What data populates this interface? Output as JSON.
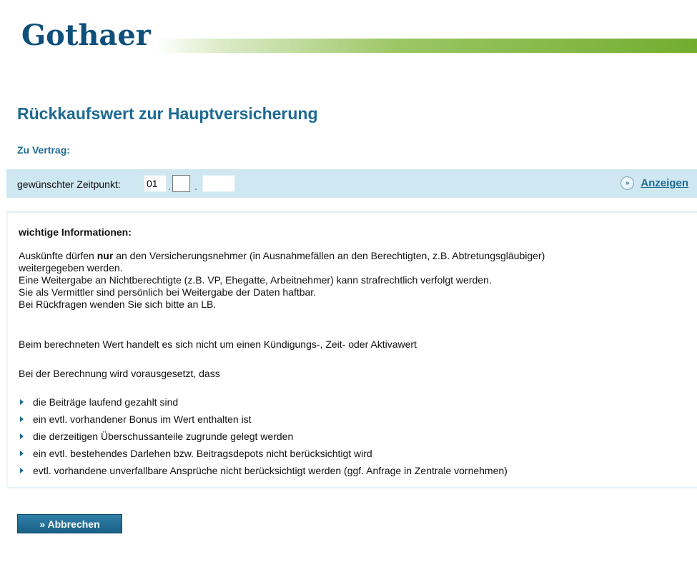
{
  "header": {
    "logo_text": "Gothaer",
    "brand_color": "#0e4f7c",
    "bar_color": "#72ad2f"
  },
  "page": {
    "title": "Rückkaufswert zur Hauptversicherung",
    "contract_label": "Zu Vertrag:"
  },
  "date_form": {
    "label": "gewünschter Zeitpunkt:",
    "day": "01",
    "separator": ".",
    "month": "",
    "year": "",
    "show_label": "Anzeigen",
    "show_icon": "double-chevron-right-icon"
  },
  "info": {
    "heading": "wichtige Informationen:",
    "para1_a": "Auskünfte dürfen ",
    "para1_bold": "nur",
    "para1_b": " an den Versicherungsnehmer (in Ausnahmefällen an den Berechtigten, z.B. Abtretungsgläubiger)",
    "para1_lines": [
      "weitergegeben werden.",
      "Eine Weitergabe an Nichtberechtigte (z.B. VP, Ehegatte, Arbeitnehmer) kann strafrechtlich verfolgt werden.",
      "Sie als Vermittler sind persönlich bei Weitergabe der Daten haftbar.",
      "Bei Rückfragen wenden Sie sich bitte an LB."
    ],
    "para2": "Beim berechneten Wert handelt es sich nicht um einen Kündigungs-, Zeit- oder Aktivawert",
    "para3": "Bei der Berechnung wird vorausgesetzt, dass",
    "bullets": [
      "die Beiträge laufend gezahlt sind",
      "ein evtl. vorhandener Bonus im Wert enthalten ist",
      "die derzeitigen Überschussanteile zugrunde gelegt werden",
      "ein evtl. bestehendes Darlehen bzw. Beitragsdepots nicht berücksichtigt wird",
      "evtl. vorhandene unverfallbare Ansprüche nicht berücksichtigt werden (ggf. Anfrage in Zentrale vornehmen)"
    ]
  },
  "actions": {
    "cancel_label": "» Abbrechen"
  }
}
